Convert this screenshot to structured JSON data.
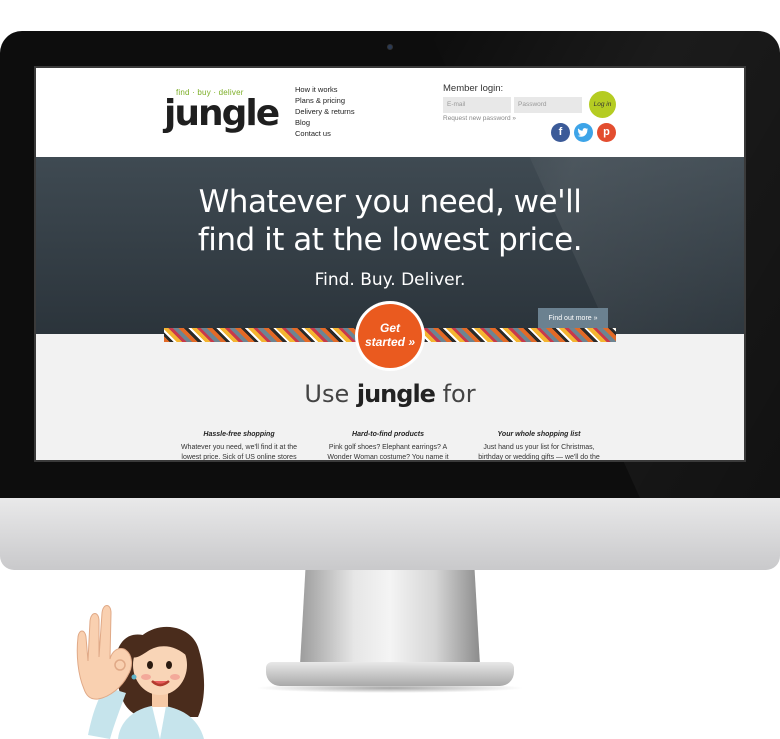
{
  "header": {
    "logo_tagline": "find · buy · deliver",
    "logo_word": "jungle",
    "nav": [
      "How it works",
      "Plans & pricing",
      "Delivery & returns",
      "Blog",
      "Contact us"
    ],
    "login": {
      "title": "Member login:",
      "email_placeholder": "E-mail",
      "password_placeholder": "Password",
      "button": "Log in",
      "forgot": "Request new password »"
    },
    "social": {
      "facebook": "f",
      "twitter": "t",
      "pinterest": "p"
    }
  },
  "hero": {
    "title_line1": "Whatever you need, we'll",
    "title_line2": "find it at the lowest price.",
    "subtitle": "Find. Buy. Deliver.",
    "find_out_button": "Find out more »",
    "get_started_line1": "Get",
    "get_started_line2": "started »"
  },
  "content": {
    "heading_prefix": "Use ",
    "heading_brand": "jungle",
    "heading_suffix": " for",
    "features": [
      {
        "title": "Hassle-free shopping",
        "text": "Whatever you need, we'll find it at the lowest price. Sick of US online stores"
      },
      {
        "title": "Hard-to-find products",
        "text": "Pink golf shoes? Elephant earrings? A Wonder Woman costume? You name it"
      },
      {
        "title": "Your whole shopping list",
        "text": "Just hand us your list for Christmas, birthday or wedding gifts — we'll do the"
      }
    ]
  },
  "colors": {
    "brand_green": "#7cae26",
    "hero_bg": "#333d44",
    "cta_orange": "#ea5a1f",
    "login_green": "#b5cc22"
  }
}
